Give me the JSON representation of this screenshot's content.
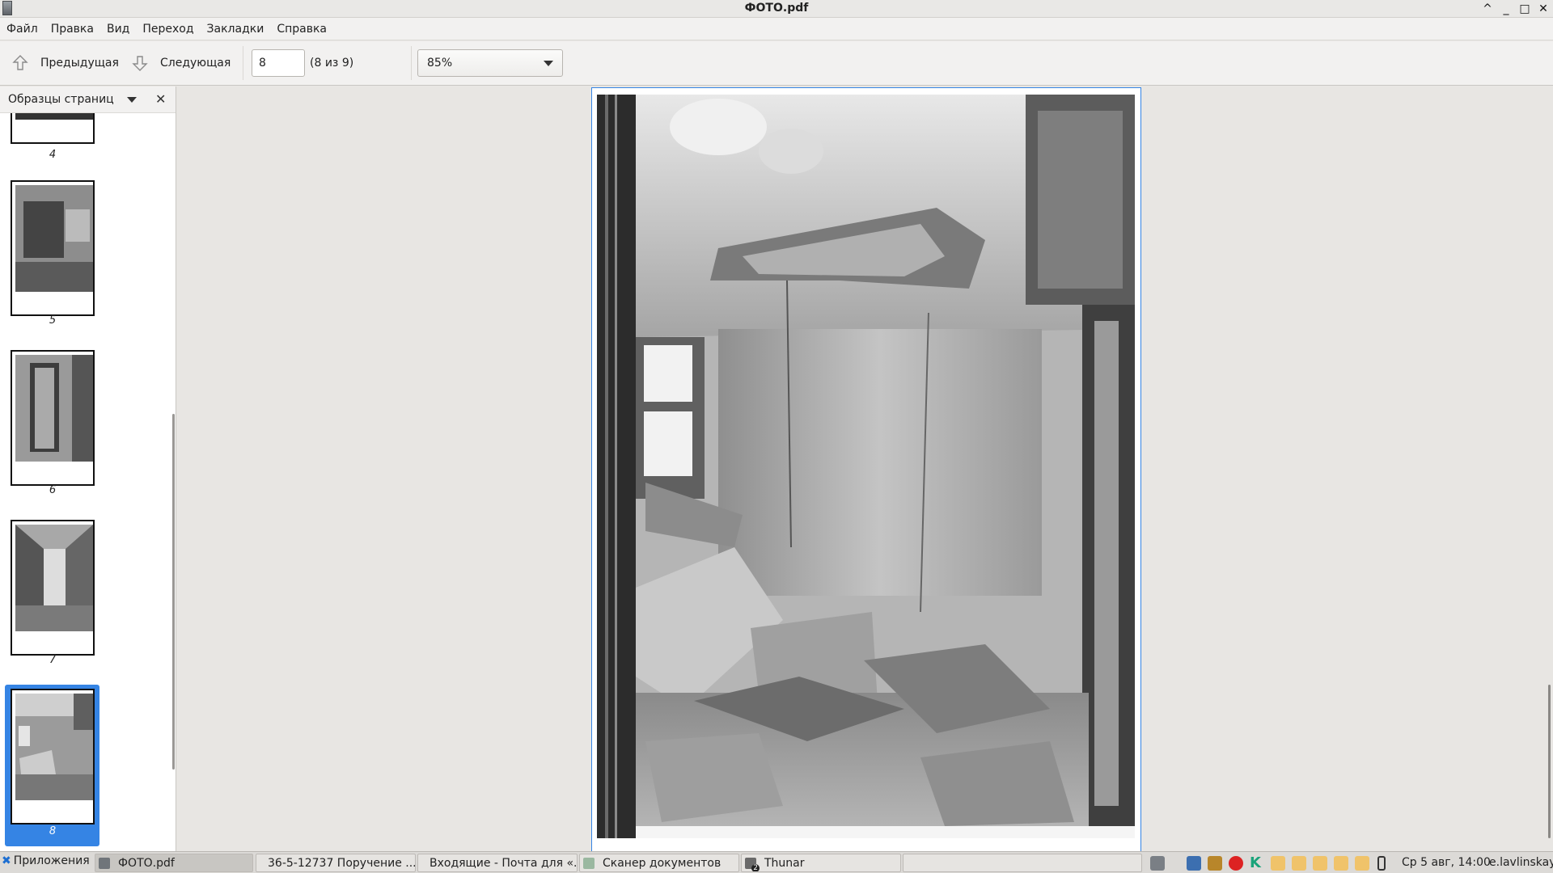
{
  "window": {
    "title": "ФОТО.pdf",
    "controls": [
      "^",
      "_",
      "□",
      "✕"
    ]
  },
  "menubar": {
    "items": [
      "Файл",
      "Правка",
      "Вид",
      "Переход",
      "Закладки",
      "Справка"
    ]
  },
  "toolbar": {
    "prev_label": "Предыдущая",
    "next_label": "Следующая",
    "page_value": "8",
    "page_count": "(8 из 9)",
    "zoom_value": "85%"
  },
  "sidebar": {
    "title": "Образцы страниц",
    "thumbnails": [
      {
        "label": "4"
      },
      {
        "label": "5"
      },
      {
        "label": "6"
      },
      {
        "label": "7"
      },
      {
        "label": "8",
        "selected": true
      }
    ]
  },
  "taskbar": {
    "apps_label": "Приложения",
    "tasks": [
      {
        "label": "ФОТО.pdf",
        "icon": "document-icon"
      },
      {
        "label": "36-5-12737 Поручение ...",
        "icon": "browser-icon"
      },
      {
        "label": "Входящие - Почта для «...",
        "icon": "mail-icon"
      },
      {
        "label": "Сканер документов",
        "icon": "scanner-icon"
      },
      {
        "label": "Thunar",
        "icon": "folder-icon",
        "badge": "2"
      }
    ],
    "clock": "Ср 5 авг, 14:00",
    "user": "e.lavlinskaya"
  },
  "colors": {
    "accent": "#3584e4",
    "background": "#e8e6e3"
  }
}
